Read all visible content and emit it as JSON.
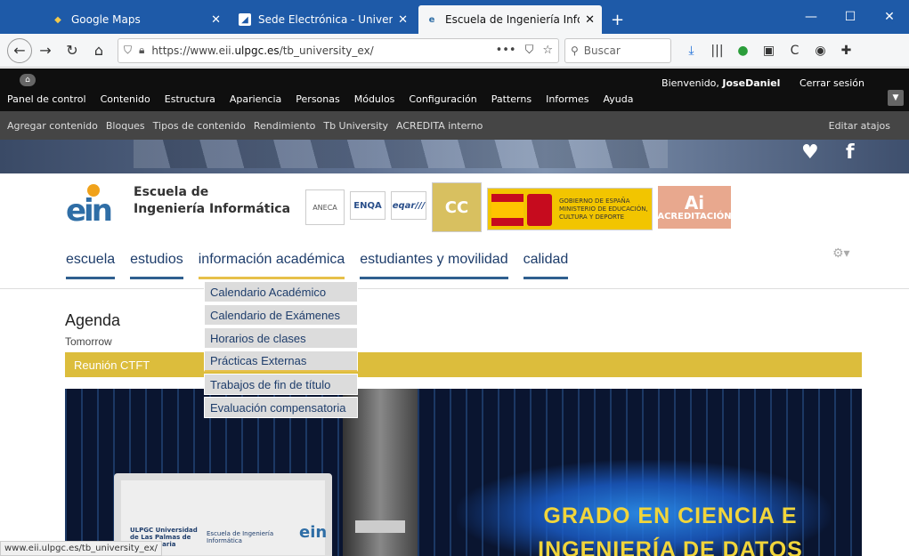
{
  "browser": {
    "tabs": [
      {
        "title": "Google Maps",
        "icon": "maps-pin-icon",
        "active": false
      },
      {
        "title": "Sede Electrónica - Universidad",
        "icon": "sede-icon",
        "active": false
      },
      {
        "title": "Escuela de Ingeniería Informátic",
        "icon": "eii-icon",
        "active": true
      }
    ],
    "new_tab": "+",
    "close": "✕",
    "url_prefix": "https://www.eii.",
    "url_domain": "ulpgc.es",
    "url_suffix": "/tb_university_ex/",
    "search_placeholder": "Buscar",
    "status_url": "www.eii.ulpgc.es/tb_university_ex/"
  },
  "admin": {
    "menu": [
      "Panel de control",
      "Contenido",
      "Estructura",
      "Apariencia",
      "Personas",
      "Módulos",
      "Configuración",
      "Patterns",
      "Informes",
      "Ayuda"
    ],
    "welcome": "Bienvenido,",
    "user": "JoseDaniel",
    "logout": "Cerrar sesión",
    "shortcuts": [
      "Agregar contenido",
      "Bloques",
      "Tipos de contenido",
      "Rendimiento",
      "Tb University",
      "ACREDITA interno"
    ],
    "edit_shortcuts": "Editar atajos"
  },
  "site": {
    "name_line1": "Escuela de",
    "name_line2": "Ingeniería Informática",
    "logo_text": "ein",
    "badges": {
      "aneca": "ANECA",
      "enqa": "ENQA",
      "eqar": "eqar///",
      "audit": "CC",
      "gobierno_a": "GOBIERNO DE ESPAÑA",
      "gobierno_b": "MINISTERIO DE EDUCACIÓN, CULTURA Y DEPORTE",
      "ai_mark": "Ai",
      "acreditacion": "ACREDITACIÓN"
    },
    "nav": [
      "escuela",
      "estudios",
      "información académica",
      "estudiantes y movilidad",
      "calidad"
    ],
    "active_nav_index": 2
  },
  "dropdown": [
    "Calendario Académico",
    "Calendario de Exámenes",
    "Horarios de clases",
    "Prácticas Externas",
    "Trabajos de fin de título",
    "Evaluación compensatoria"
  ],
  "agenda": {
    "title": "Agenda",
    "sub": "Tomorrow",
    "event": "Reunión CTFT"
  },
  "hero": {
    "line1": "GRADO EN CIENCIA E",
    "line2": "INGENIERÍA DE DATOS",
    "ulpgc_text": "ULPGC Universidad de Las Palmas de Gran Canaria",
    "eii_text": "Escuela de Ingeniería Informática",
    "logo_text": "ein"
  }
}
